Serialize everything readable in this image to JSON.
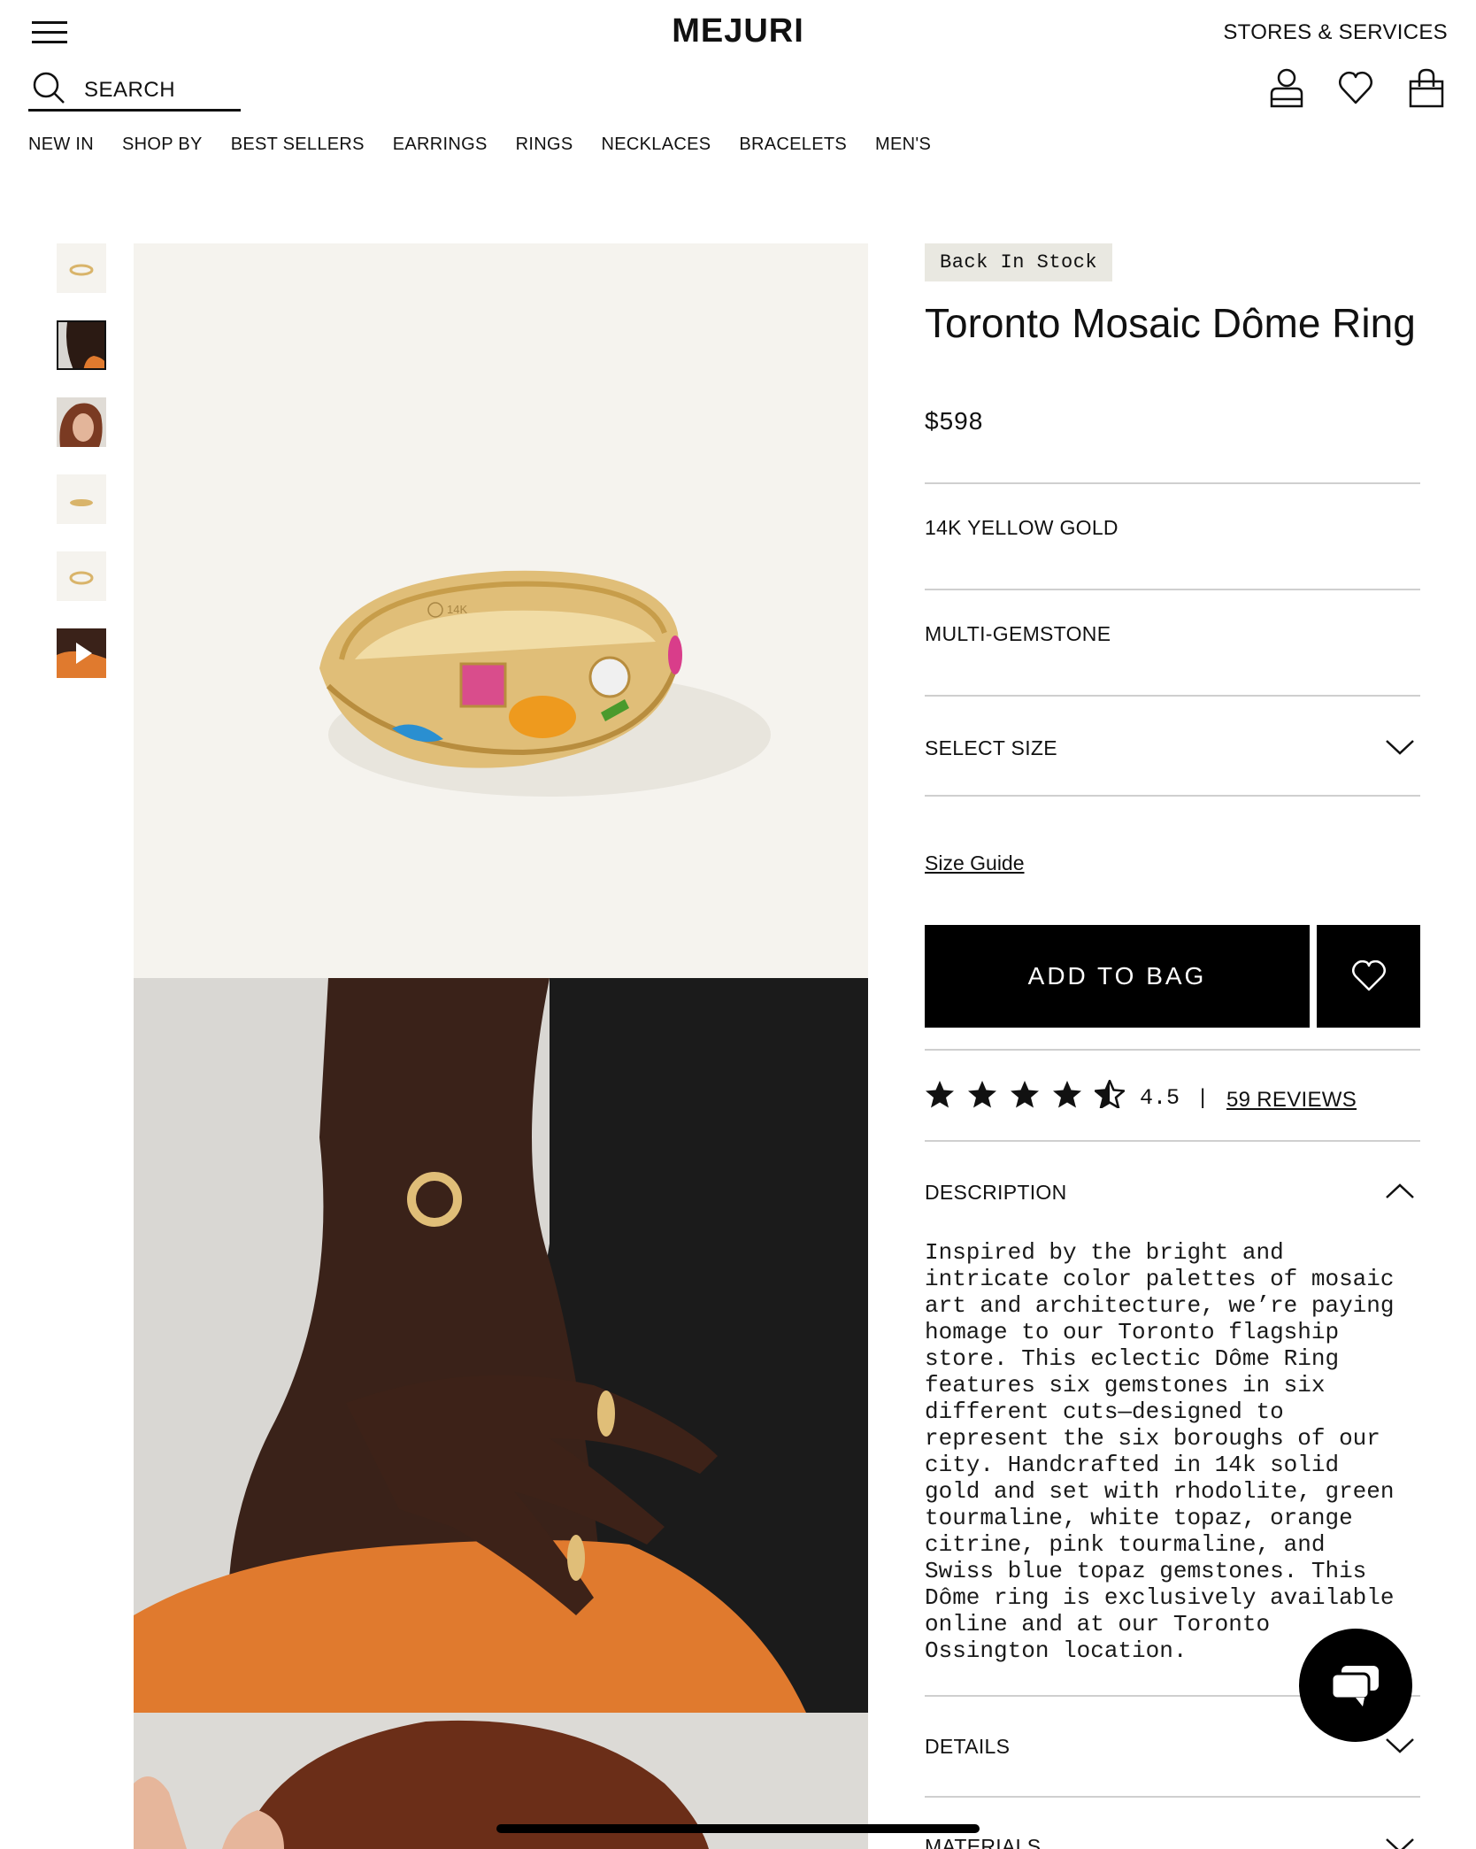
{
  "header": {
    "logo": "MEJURI",
    "stores_label": "STORES & SERVICES",
    "search_label": "SEARCH"
  },
  "nav": [
    "NEW IN",
    "SHOP BY",
    "BEST SELLERS",
    "EARRINGS",
    "RINGS",
    "NECKLACES",
    "BRACELETS",
    "MEN'S"
  ],
  "product": {
    "badge": "Back In Stock",
    "title": "Toronto Mosaic Dôme Ring",
    "price": "$598",
    "metal": "14K YELLOW GOLD",
    "stone": "MULTI-GEMSTONE",
    "select_size": "SELECT SIZE",
    "size_guide": "Size Guide",
    "add_to_bag": "ADD TO BAG",
    "rating": {
      "value": 4.5,
      "value_label": "4.5",
      "separator": "|",
      "reviews_label": "59 REVIEWS"
    },
    "ring_engraving": "14K"
  },
  "accordion": {
    "description_label": "DESCRIPTION",
    "description_text": "Inspired by the bright and\nintricate color palettes of mosaic\nart and architecture, we’re paying\nhomage to our Toronto flagship\nstore. This eclectic Dôme Ring\nfeatures six gemstones in six\ndifferent cuts—designed to\nrepresent the six boroughs of our\ncity. Handcrafted in 14k solid\ngold and set with rhodolite, green\ntourmaline, white topaz, orange\ncitrine, pink tourmaline, and\nSwiss blue topaz gemstones. This\nDôme ring is exclusively available\nonline and at our Toronto\nOssington location.",
    "details_label": "DETAILS",
    "materials_label": "MATERIALS"
  },
  "thumbnails": [
    "ring-product",
    "model-ear-hand",
    "model-face",
    "ring-side",
    "ring-top",
    "video"
  ],
  "colors": {
    "badge_bg": "#e9e8e1",
    "image_bg": "#f5f3ee",
    "gold": "#d9b46a",
    "button_bg": "#000000",
    "skin": "#3a2219",
    "garment": "#e07a2e"
  }
}
